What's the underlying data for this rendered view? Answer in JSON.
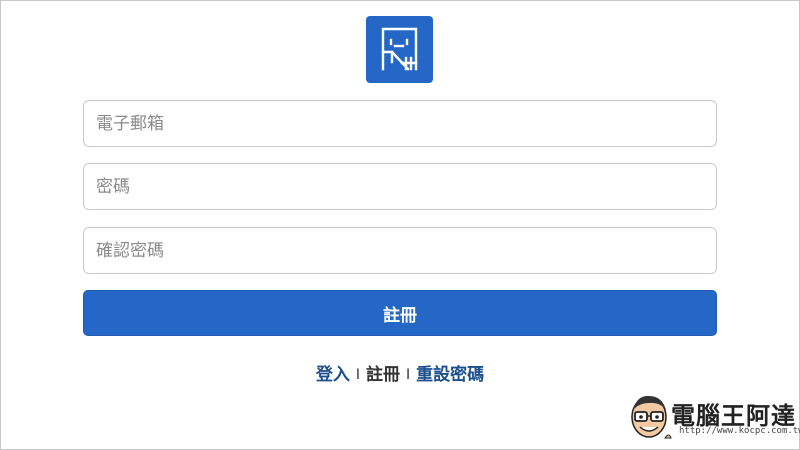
{
  "form": {
    "email_placeholder": "電子郵箱",
    "password_placeholder": "密碼",
    "confirm_password_placeholder": "確認密碼",
    "submit_label": "註冊"
  },
  "links": {
    "login": "登入",
    "separator": "I",
    "register": "註冊",
    "reset_password": "重設密碼"
  },
  "watermark": {
    "text": "電腦王阿達",
    "url": "http://www.kocpc.com.tw"
  },
  "colors": {
    "accent": "#2567c7",
    "link": "#1d4f8f",
    "border": "#c9c9c9"
  },
  "icons": {
    "logo": "app-logo-icon"
  }
}
